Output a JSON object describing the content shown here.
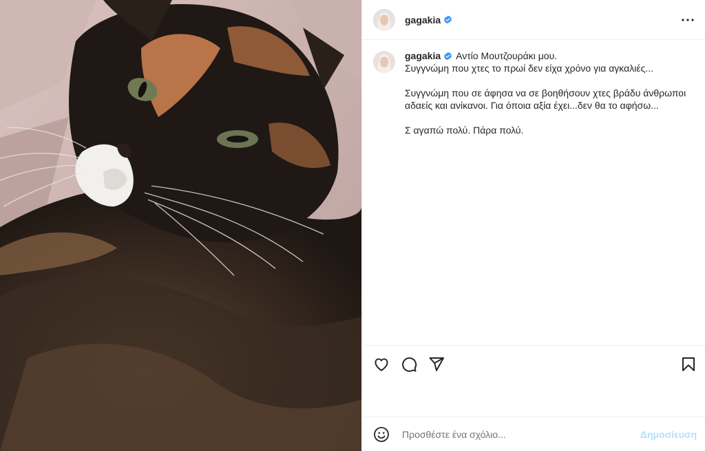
{
  "post": {
    "username": "gagakia",
    "verified_icon": "verified-badge-icon",
    "more_icon": "more-options-icon",
    "image_subject": "cat-photo"
  },
  "caption": {
    "username": "gagakia",
    "line1": "Αντίο Μουτζουράκι μου.",
    "line2": "Συγγνώμη που χτες το πρωί δεν είχα χρόνο για αγκαλιές...",
    "para2": "Συγγνώμη που σε άφησα να σε βοηθήσουν χτες βράδυ άνθρωποι αδαείς και ανίκανοι. Για όποια αξία έχει...δεν θα το αφήσω...",
    "para3": "Σ αγαπώ πολύ. Πάρα πολύ."
  },
  "actions": {
    "like_icon": "heart-icon",
    "comment_icon": "comment-icon",
    "share_icon": "share-icon",
    "save_icon": "bookmark-icon"
  },
  "comment": {
    "placeholder": "Προσθέστε ένα σχόλιο...",
    "post_label": "Δημοσίευση",
    "emoji_icon": "emoji-icon"
  },
  "colors": {
    "verified": "#3897f0",
    "post_button_disabled": "#b2dffc",
    "text": "#262626",
    "muted": "#737373",
    "border": "#efefef"
  }
}
